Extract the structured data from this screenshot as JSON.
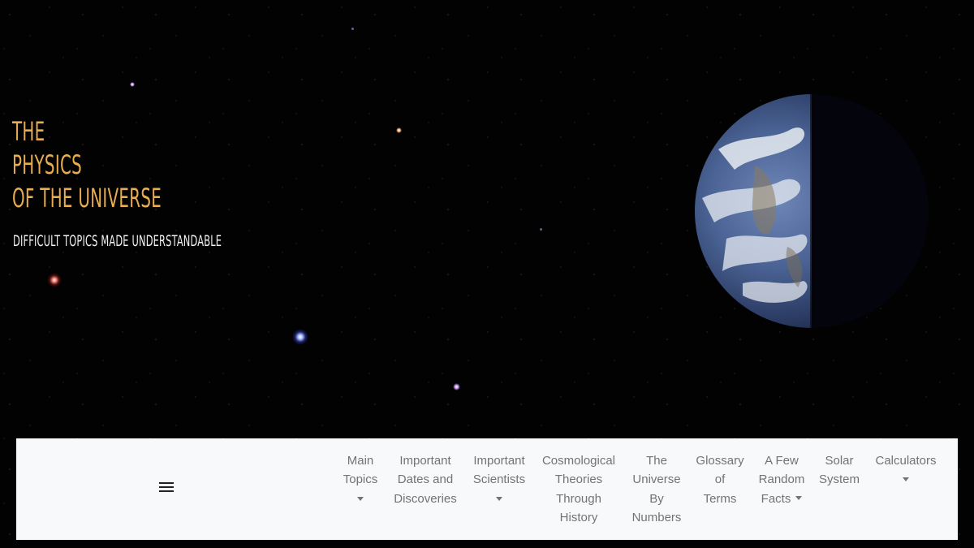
{
  "site": {
    "title_lines": [
      "THE",
      "PHYSICS",
      "OF THE UNIVERSE"
    ],
    "tagline": "DIFFICULT TOPICS MADE UNDERSTANDABLE"
  },
  "colors": {
    "title": "#e9ad4f",
    "tagline": "#f2f2f2",
    "nav_text": "#737373",
    "navbar_bg": "#f8f9fb",
    "sky": "#020203"
  },
  "navbar": {
    "toggler_icon": "hamburger-menu-icon",
    "items": [
      {
        "lines": [
          "Main",
          "Topics"
        ],
        "dropdown": true
      },
      {
        "lines": [
          "Important",
          "Dates and",
          "Discoveries"
        ],
        "dropdown": false
      },
      {
        "lines": [
          "Important",
          "Scientists"
        ],
        "dropdown": true
      },
      {
        "lines": [
          "Cosmological",
          "Theories",
          "Through",
          "History"
        ],
        "dropdown": false
      },
      {
        "lines": [
          "The",
          "Universe",
          "By",
          "Numbers"
        ],
        "dropdown": false
      },
      {
        "lines": [
          "Glossary",
          "of",
          "Terms"
        ],
        "dropdown": false
      },
      {
        "lines": [
          "A Few",
          "Random",
          "Facts"
        ],
        "dropdown": true
      },
      {
        "lines": [
          "Solar",
          "System"
        ],
        "dropdown": false
      },
      {
        "lines": [
          "Calculators"
        ],
        "dropdown": true
      }
    ]
  }
}
